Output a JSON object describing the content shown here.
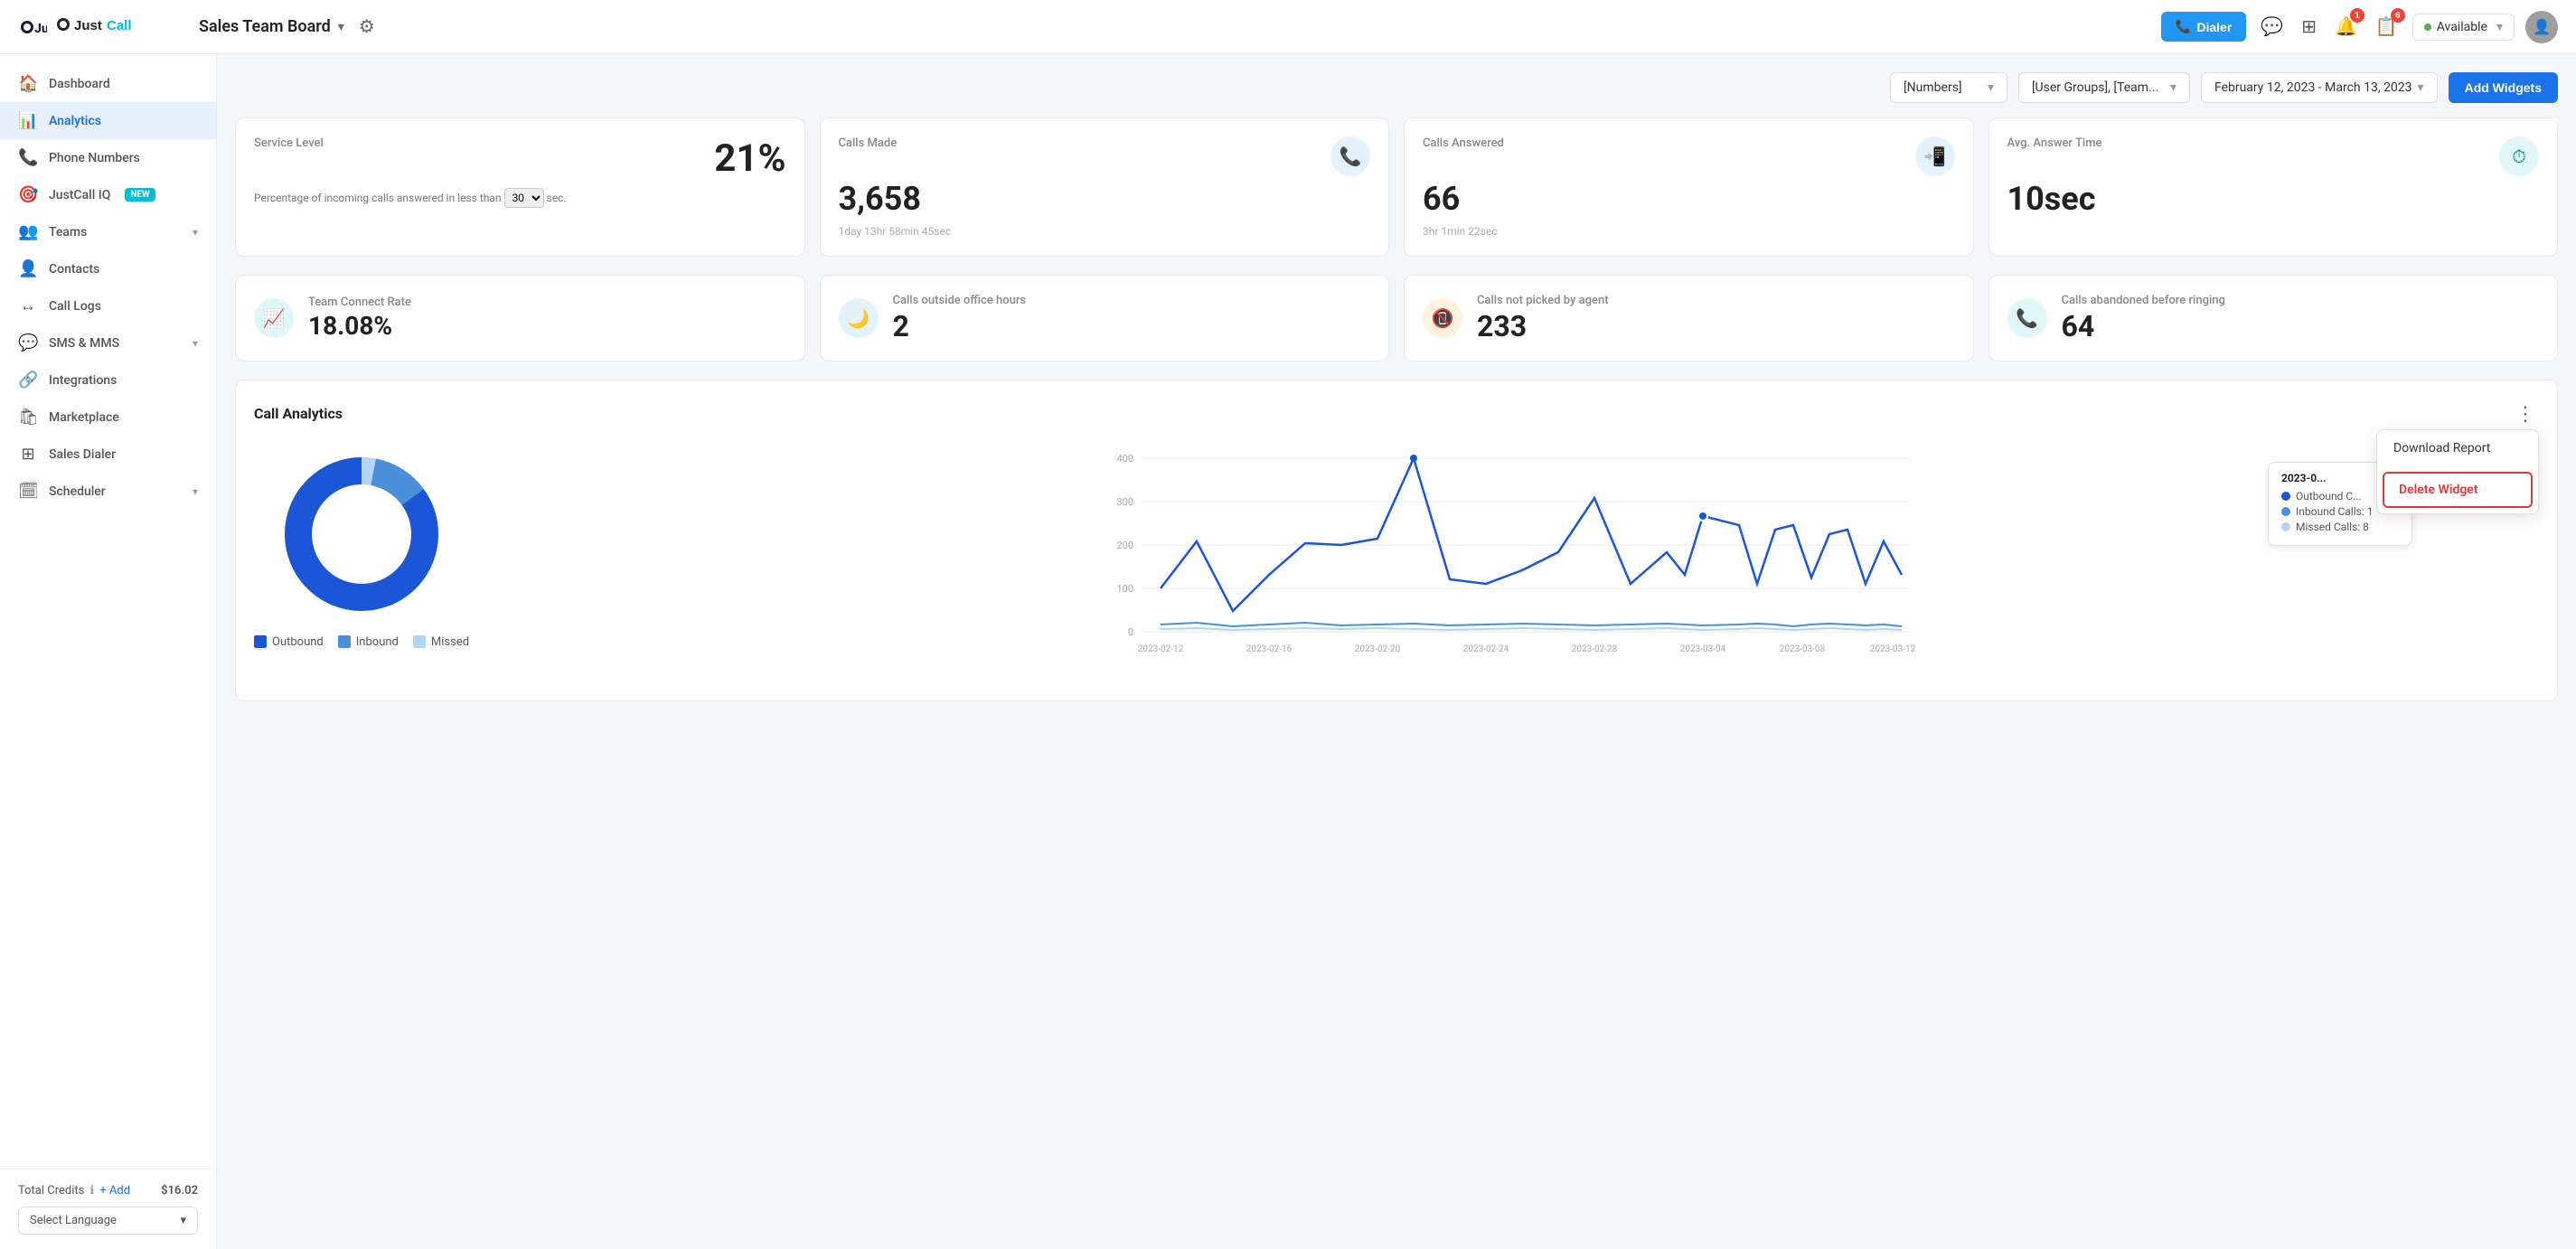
{
  "app": {
    "name": "JustCall",
    "logo_icon": "☎"
  },
  "header": {
    "page_title": "Sales Team Board",
    "gear_label": "⚙",
    "dialer_label": "Dialer",
    "status": "Available",
    "notification_count": "1",
    "message_count": "6"
  },
  "sidebar": {
    "items": [
      {
        "id": "dashboard",
        "label": "Dashboard",
        "icon": "🏠",
        "active": false
      },
      {
        "id": "analytics",
        "label": "Analytics",
        "icon": "📊",
        "active": true
      },
      {
        "id": "phone-numbers",
        "label": "Phone Numbers",
        "icon": "📞",
        "active": false
      },
      {
        "id": "justcall-iq",
        "label": "JustCall IQ",
        "icon": "🎯",
        "active": false,
        "badge": "NEW"
      },
      {
        "id": "teams",
        "label": "Teams",
        "icon": "👥",
        "active": false,
        "has_arrow": true
      },
      {
        "id": "contacts",
        "label": "Contacts",
        "icon": "👤",
        "active": false
      },
      {
        "id": "call-logs",
        "label": "Call Logs",
        "icon": "↔",
        "active": false
      },
      {
        "id": "sms-mms",
        "label": "SMS & MMS",
        "icon": "💬",
        "active": false,
        "has_arrow": true
      },
      {
        "id": "integrations",
        "label": "Integrations",
        "icon": "🔗",
        "active": false
      },
      {
        "id": "marketplace",
        "label": "Marketplace",
        "icon": "🛍",
        "active": false
      },
      {
        "id": "sales-dialer",
        "label": "Sales Dialer",
        "icon": "⊞",
        "active": false
      },
      {
        "id": "scheduler",
        "label": "Scheduler",
        "icon": "🗓",
        "active": false,
        "has_arrow": true
      }
    ],
    "credits_label": "Total Credits",
    "credits_add": "+ Add",
    "credits_amount": "$16.02",
    "language_label": "Select Language"
  },
  "filters": {
    "numbers_label": "[Numbers]",
    "groups_label": "[User Groups], [Team...",
    "date_label": "February 12, 2023 - March 13, 2023",
    "add_widgets_label": "Add Widgets"
  },
  "metrics_row1": [
    {
      "id": "service-level",
      "label": "Service Level",
      "value": "21%",
      "description": "Percentage of incoming calls answered in less than",
      "sec_value": "30",
      "sec_suffix": "sec.",
      "type": "service"
    },
    {
      "id": "calls-made",
      "label": "Calls Made",
      "value": "3,658",
      "sub": "1day 13hr 58min 45sec",
      "icon": "📞",
      "icon_class": "icon-blue"
    },
    {
      "id": "calls-answered",
      "label": "Calls Answered",
      "value": "66",
      "sub": "3hr 1min 22sec",
      "icon": "📲",
      "icon_class": "icon-blue"
    },
    {
      "id": "avg-answer-time",
      "label": "Avg. Answer Time",
      "value": "10sec",
      "icon": "⏱",
      "icon_class": "icon-teal"
    }
  ],
  "metrics_row2": [
    {
      "id": "team-connect-rate",
      "label": "Team Connect Rate",
      "value": "18.08%",
      "icon": "📈",
      "icon_class": "icon-teal"
    },
    {
      "id": "calls-outside-hours",
      "label": "Calls outside office hours",
      "value": "2",
      "icon": "📵",
      "icon_class": "icon-blue"
    },
    {
      "id": "calls-not-picked",
      "label": "Calls not picked by agent",
      "value": "233",
      "icon": "📲",
      "icon_class": "icon-orange"
    },
    {
      "id": "calls-abandoned",
      "label": "Calls abandoned before ringing",
      "value": "64",
      "icon": "📞",
      "icon_class": "icon-teal"
    }
  ],
  "call_analytics": {
    "title": "Call Analytics",
    "context_menu": {
      "download_label": "Download Report",
      "delete_label": "Delete Widget"
    },
    "donut": {
      "outbound_pct": 85,
      "inbound_pct": 12,
      "missed_pct": 3
    },
    "legend": [
      {
        "label": "Outbound",
        "color": "#1a56d6"
      },
      {
        "label": "Inbound",
        "color": "#4a90d9"
      },
      {
        "label": "Missed",
        "color": "#b3d4f5"
      }
    ],
    "tooltip": {
      "date": "2023-0...",
      "outbound_label": "Outbound C...",
      "inbound_label": "Inbound Calls: 1",
      "missed_label": "Missed Calls: 8"
    },
    "chart": {
      "y_labels": [
        "400",
        "300",
        "200",
        "100",
        "0"
      ],
      "x_labels": [
        "2023-02-12",
        "2023-02-16",
        "2023-02-20",
        "2023-02-24",
        "2023-02-28",
        "2023-03-04",
        "2023-03-08",
        "2023-03-12"
      ]
    }
  }
}
